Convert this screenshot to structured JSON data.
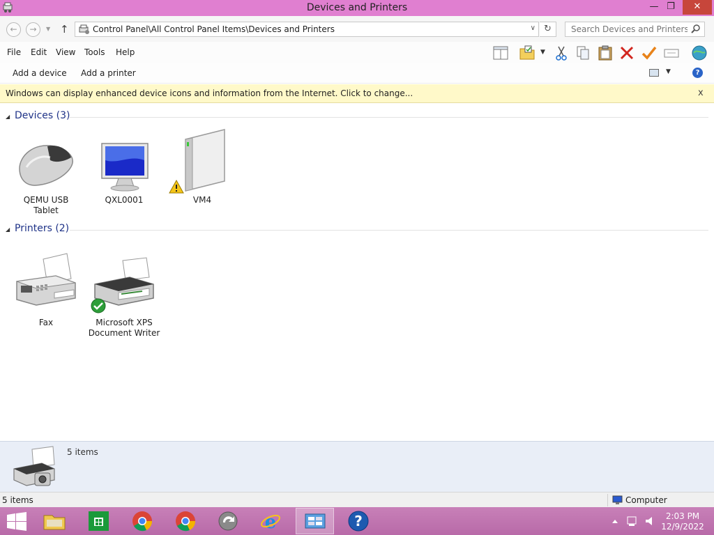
{
  "window": {
    "title": "Devices and Printers",
    "minimize": "—",
    "maximize": "❐",
    "close": "✕"
  },
  "address": {
    "path": "Control Panel\\All Control Panel Items\\Devices and Printers",
    "search_placeholder": "Search Devices and Printers"
  },
  "menu": {
    "items": [
      "File",
      "Edit",
      "View",
      "Tools",
      "Help"
    ]
  },
  "commands": {
    "add_device": "Add a device",
    "add_printer": "Add a printer"
  },
  "infobar": {
    "message": "Windows can display enhanced device icons and information from the Internet. Click to change...",
    "close": "x"
  },
  "groups": {
    "devices": {
      "label": "Devices (3)",
      "items": [
        {
          "label": "QEMU USB Tablet",
          "icon": "mouse-icon"
        },
        {
          "label": "QXL0001",
          "icon": "monitor-icon"
        },
        {
          "label": "VM4",
          "icon": "computer-tower-icon",
          "warning": true
        }
      ]
    },
    "printers": {
      "label": "Printers (2)",
      "items": [
        {
          "label": "Fax",
          "icon": "fax-icon"
        },
        {
          "label": "Microsoft XPS Document Writer",
          "icon": "printer-icon",
          "default": true
        }
      ]
    }
  },
  "details": {
    "count": "5 items"
  },
  "status": {
    "left": "5 items",
    "right": "Computer"
  },
  "taskbar": {
    "time": "2:03 PM",
    "date": "12/9/2022"
  },
  "colors": {
    "titlebar": "#e07fd0",
    "close": "#c7463b",
    "group_header": "#1e3287",
    "infobar": "#fff9c9"
  }
}
